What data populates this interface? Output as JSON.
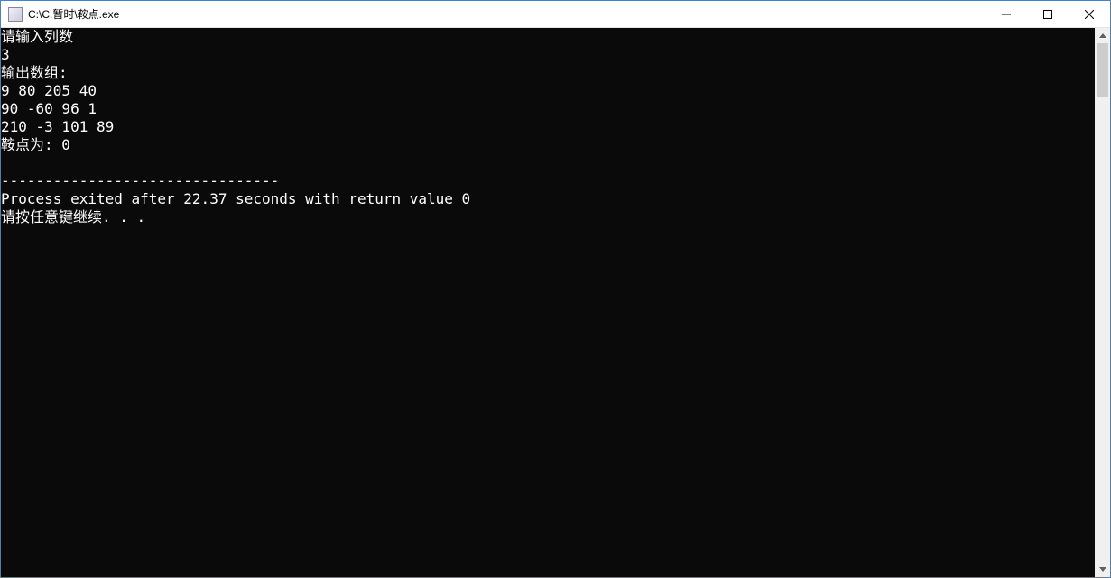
{
  "window": {
    "title": "C:\\C.暂时\\鞍点.exe"
  },
  "console": {
    "lines": [
      "请输入列数",
      "3",
      "输出数组:",
      "9 80 205 40",
      "90 -60 96 1",
      "210 -3 101 89",
      "鞍点为: 0",
      "",
      "--------------------------------",
      "Process exited after 22.37 seconds with return value 0",
      "请按任意键继续. . ."
    ]
  }
}
